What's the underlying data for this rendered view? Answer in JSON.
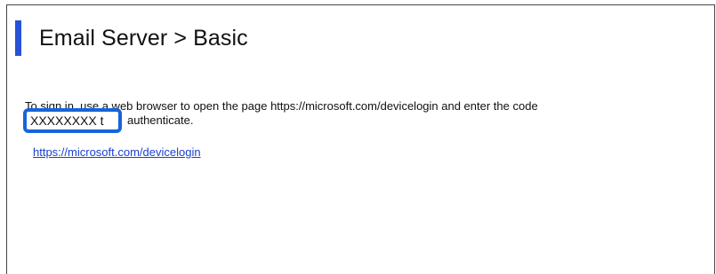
{
  "header": {
    "title": "Email Server > Basic"
  },
  "instructions": {
    "line1": "To sign in, use a web browser to open the page https://microsoft.com/devicelogin and enter the code",
    "code": "XXXXXXXX t",
    "line2_rest": "authenticate."
  },
  "link": {
    "text": "https://microsoft.com/devicelogin"
  },
  "colors": {
    "accent": "#2752d6",
    "highlight_border": "#1664d9",
    "link": "#1a3fd0"
  }
}
